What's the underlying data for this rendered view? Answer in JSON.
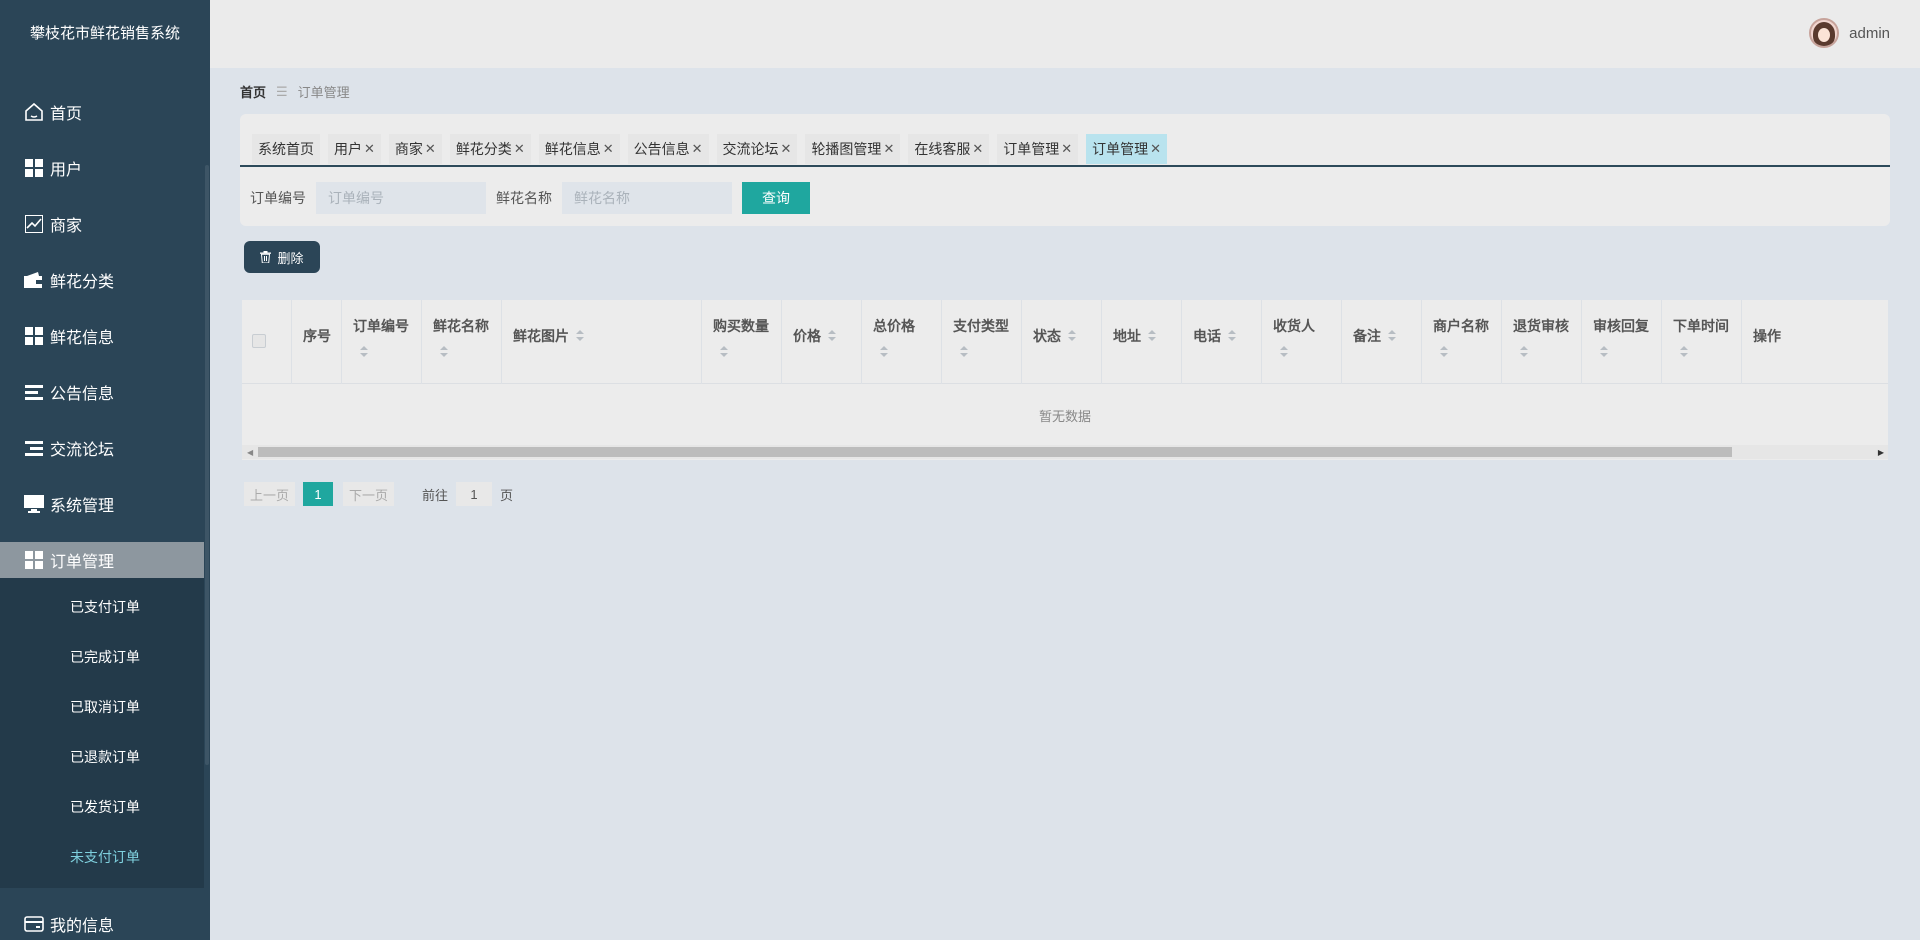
{
  "app": {
    "title": "攀枝花市鲜花销售系统"
  },
  "sidebar": {
    "items": [
      {
        "label": "首页",
        "icon": "home-icon"
      },
      {
        "label": "用户",
        "icon": "grid-icon"
      },
      {
        "label": "商家",
        "icon": "chart-icon"
      },
      {
        "label": "鲜花分类",
        "icon": "wallet-icon"
      },
      {
        "label": "鲜花信息",
        "icon": "grid-icon"
      },
      {
        "label": "公告信息",
        "icon": "list-icon"
      },
      {
        "label": "交流论坛",
        "icon": "list-icon"
      },
      {
        "label": "系统管理",
        "icon": "monitor-icon"
      },
      {
        "label": "订单管理",
        "icon": "grid-icon"
      }
    ],
    "submenu": [
      "已支付订单",
      "已完成订单",
      "已取消订单",
      "已退款订单",
      "已发货订单",
      "未支付订单"
    ],
    "bottom": {
      "label": "我的信息",
      "icon": "card-icon"
    }
  },
  "header": {
    "username": "admin"
  },
  "breadcrumb": {
    "home": "首页",
    "sep": "☰",
    "current": "订单管理"
  },
  "tabs": [
    {
      "label": "系统首页",
      "closable": false
    },
    {
      "label": "用户",
      "closable": true
    },
    {
      "label": "商家",
      "closable": true
    },
    {
      "label": "鲜花分类",
      "closable": true
    },
    {
      "label": "鲜花信息",
      "closable": true
    },
    {
      "label": "公告信息",
      "closable": true
    },
    {
      "label": "交流论坛",
      "closable": true
    },
    {
      "label": "轮播图管理",
      "closable": true
    },
    {
      "label": "在线客服",
      "closable": true
    },
    {
      "label": "订单管理",
      "closable": true
    },
    {
      "label": "订单管理",
      "closable": true,
      "active": true
    }
  ],
  "search": {
    "order_no_label": "订单编号",
    "order_no_placeholder": "订单编号",
    "flower_name_label": "鲜花名称",
    "flower_name_placeholder": "鲜花名称",
    "query_button": "查询"
  },
  "toolbar": {
    "delete_label": "删除"
  },
  "table": {
    "columns": [
      {
        "label": "序号",
        "sortable": false
      },
      {
        "label": "订单编号",
        "sortable": true
      },
      {
        "label": "鲜花名称",
        "sortable": true
      },
      {
        "label": "鲜花图片",
        "sortable": true
      },
      {
        "label": "购买数量",
        "sortable": true
      },
      {
        "label": "价格",
        "sortable": true
      },
      {
        "label": "总价格",
        "sortable": true
      },
      {
        "label": "支付类型",
        "sortable": true
      },
      {
        "label": "状态",
        "sortable": true
      },
      {
        "label": "地址",
        "sortable": true
      },
      {
        "label": "电话",
        "sortable": true
      },
      {
        "label": "收货人",
        "sortable": true
      },
      {
        "label": "备注",
        "sortable": true
      },
      {
        "label": "商户名称",
        "sortable": true
      },
      {
        "label": "退货审核",
        "sortable": true
      },
      {
        "label": "审核回复",
        "sortable": true
      },
      {
        "label": "下单时间",
        "sortable": true
      },
      {
        "label": "操作",
        "sortable": false
      }
    ],
    "empty_text": "暂无数据"
  },
  "pagination": {
    "prev": "上一页",
    "current_page": "1",
    "next": "下一页",
    "goto_label": "前往",
    "goto_value": "1",
    "page_suffix": "页"
  },
  "colors": {
    "sidebar": "#2b4557",
    "accent": "#1fa79f",
    "active_tab": "#b9e3ee"
  }
}
